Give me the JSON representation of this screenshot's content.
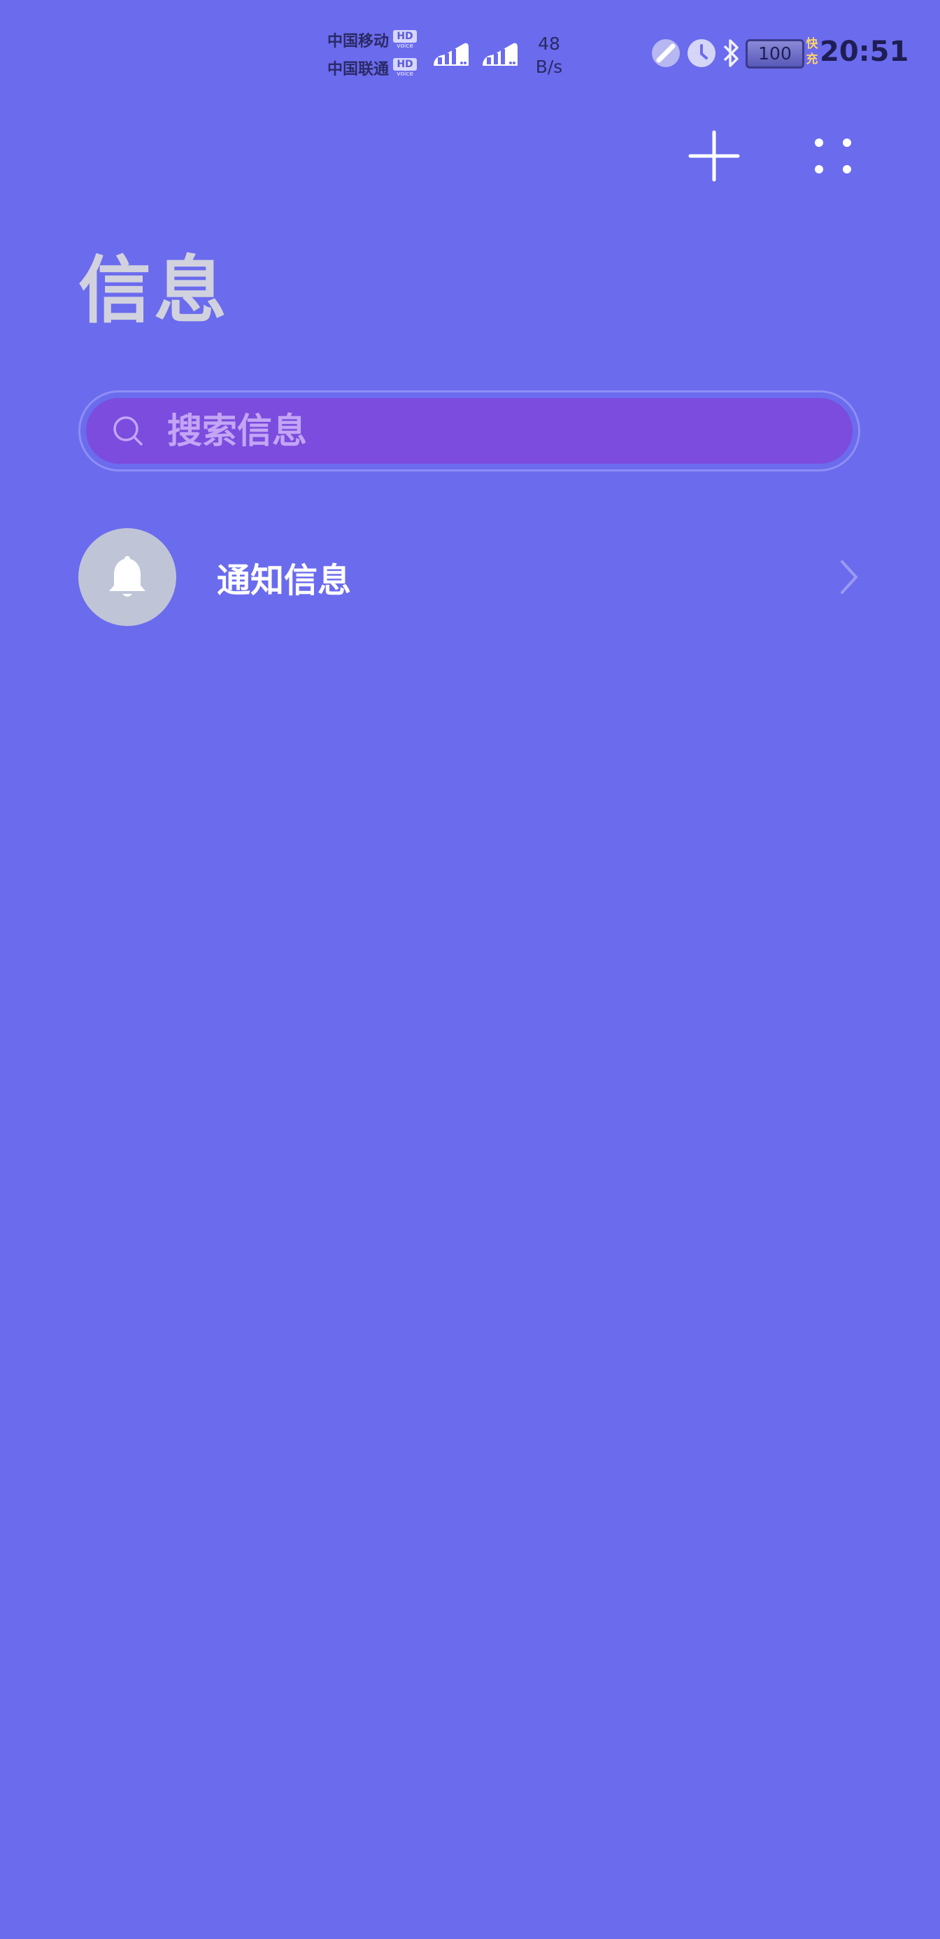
{
  "status_bar": {
    "carrier_1": "中国移动",
    "carrier_2": "中国联通",
    "hd_label": "HD",
    "voice_label": "voice",
    "net_speed_value": "48",
    "net_speed_unit": "B/s",
    "battery_level": "100",
    "fast_charge_label": "快充",
    "time": "20:51",
    "icons": [
      "signal-icon",
      "link-icon",
      "alarm-clock-icon",
      "bluetooth-icon",
      "battery-icon"
    ]
  },
  "toolbar": {
    "icons": [
      "plus-icon",
      "more-dots-icon"
    ]
  },
  "page": {
    "title": "信息"
  },
  "search": {
    "placeholder": "搜索信息",
    "icon": "search-icon"
  },
  "list": {
    "items": [
      {
        "label": "通知信息",
        "icon": "bell-icon"
      }
    ]
  },
  "colors": {
    "background": "#6B6BEE",
    "search_fill": "#7B4CDE",
    "title_text": "#D2D2DE",
    "avatar_bg": "#BFC5D7"
  }
}
